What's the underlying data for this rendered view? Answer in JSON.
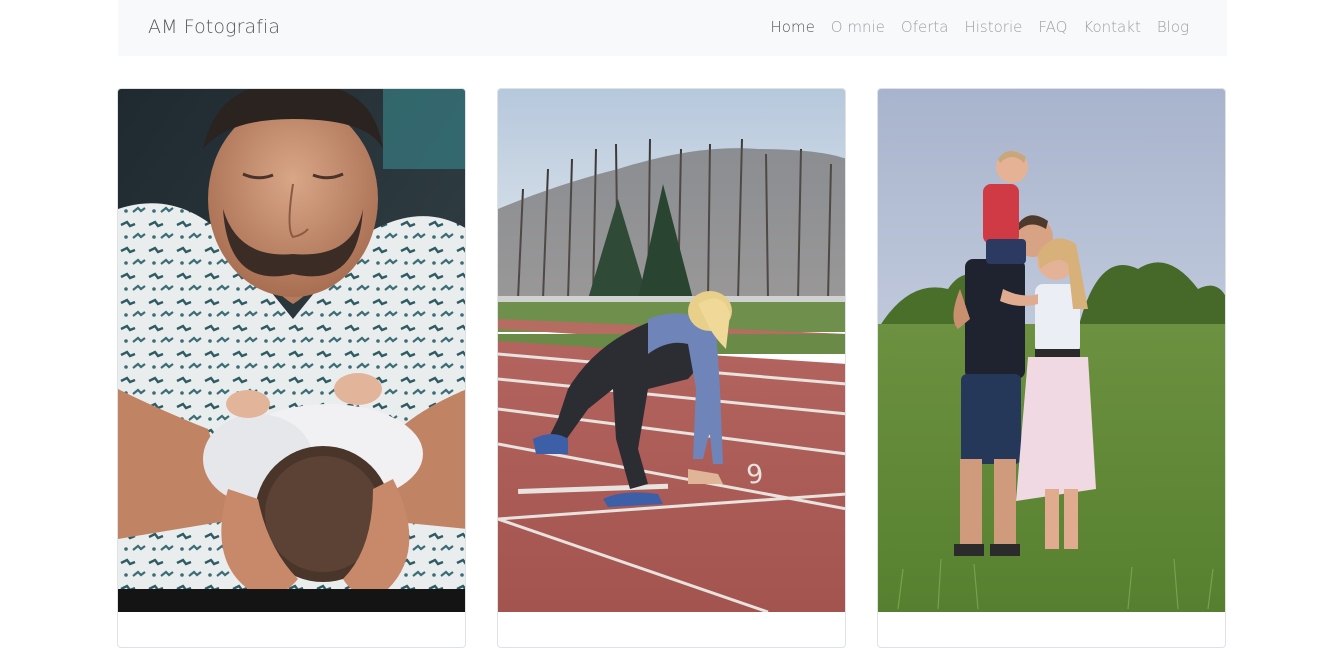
{
  "navbar": {
    "brand": "AM Fotografia",
    "links": [
      {
        "label": "Home",
        "active": true
      },
      {
        "label": "O mnie"
      },
      {
        "label": "Oferta"
      },
      {
        "label": "Historie"
      },
      {
        "label": "FAQ"
      },
      {
        "label": "Kontakt"
      },
      {
        "label": "Blog"
      }
    ]
  },
  "cards": [
    {
      "subject": "father-with-newborn-photo"
    },
    {
      "subject": "sprinter-on-track-photo"
    },
    {
      "subject": "family-in-meadow-photo"
    }
  ]
}
